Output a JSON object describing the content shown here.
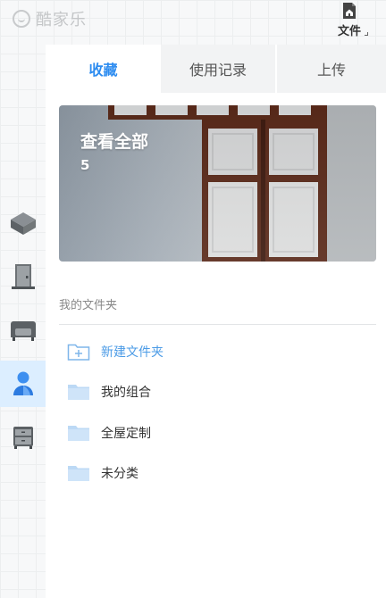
{
  "app": {
    "logo_text": "酷家乐"
  },
  "toolbar": {
    "file_label": "文件"
  },
  "tabs": [
    {
      "label": "收藏",
      "active": true
    },
    {
      "label": "使用记录",
      "active": false
    },
    {
      "label": "上传",
      "active": false
    }
  ],
  "hero": {
    "title": "查看全部",
    "count": "5"
  },
  "section": {
    "label": "我的文件夹"
  },
  "folders": [
    {
      "label": "新建文件夹",
      "type": "new"
    },
    {
      "label": "我的组合",
      "type": "folder"
    },
    {
      "label": "全屋定制",
      "type": "folder"
    },
    {
      "label": "未分类",
      "type": "folder"
    }
  ],
  "sidebar": [
    {
      "icon": "cube-icon",
      "active": false
    },
    {
      "icon": "door-icon",
      "active": false
    },
    {
      "icon": "sofa-icon",
      "active": false
    },
    {
      "icon": "user-icon",
      "active": true
    },
    {
      "icon": "cabinet-icon",
      "active": false
    }
  ],
  "colors": {
    "accent": "#2d8cf0",
    "active_bg": "#dceeff",
    "new_folder_text": "#4b9be6"
  }
}
